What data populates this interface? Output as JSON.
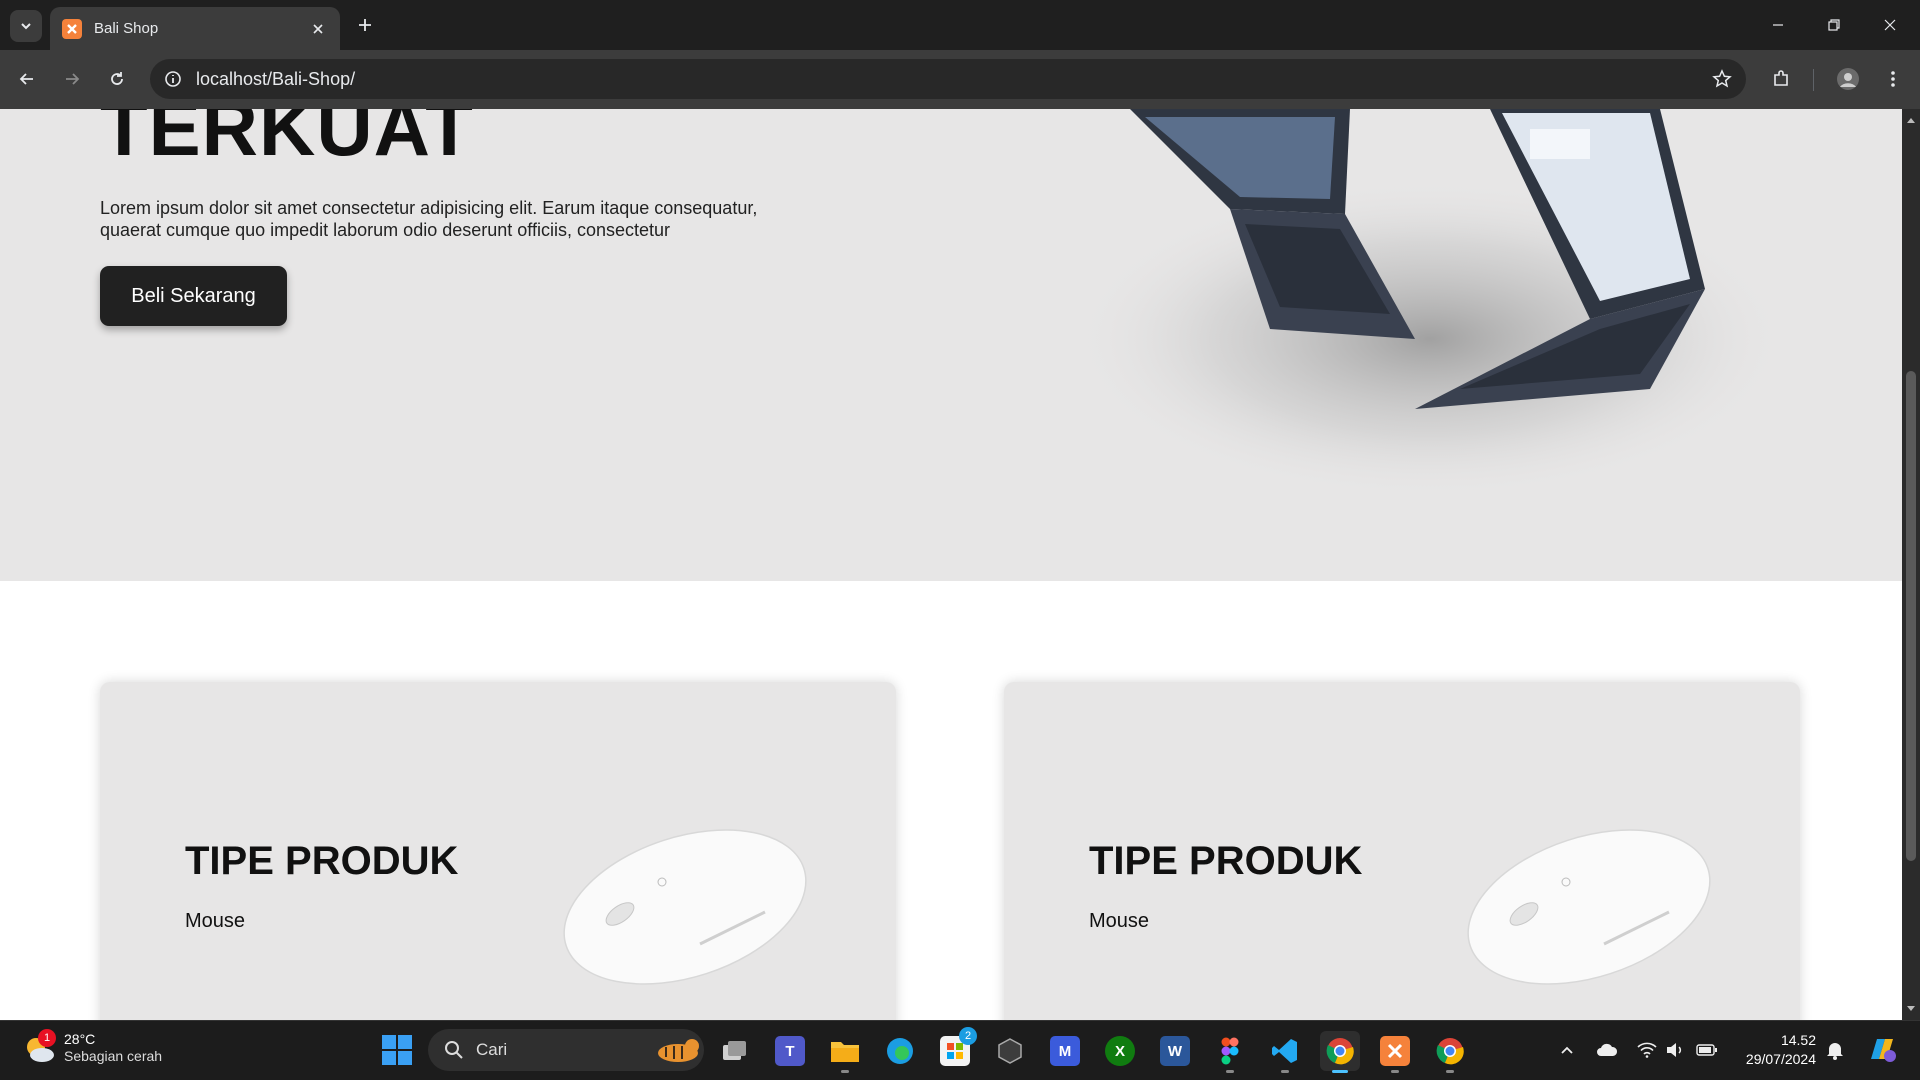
{
  "browser": {
    "tab_title": "Bali Shop",
    "url": "localhost/Bali-Shop/"
  },
  "hero": {
    "title": "TERKUAT",
    "description": "Lorem ipsum dolor sit amet consectetur adipisicing elit. Earum itaque consequatur, quaerat cumque quo impedit laborum odio deserunt officiis, consectetur",
    "button_label": "Beli Sekarang"
  },
  "cards": [
    {
      "title": "TIPE PRODUK",
      "subtitle": "Mouse"
    },
    {
      "title": "TIPE PRODUK",
      "subtitle": "Mouse"
    }
  ],
  "taskbar": {
    "weather_temp": "28°C",
    "weather_desc": "Sebagian cerah",
    "weather_badge": "1",
    "search_placeholder": "Cari",
    "store_badge": "2",
    "time": "14.52",
    "date": "29/07/2024"
  },
  "colors": {
    "hero_bg": "#e7e6e6",
    "button_bg": "#212121",
    "browser_frame": "#1f1f1f",
    "accent": "#4cc2ff"
  }
}
